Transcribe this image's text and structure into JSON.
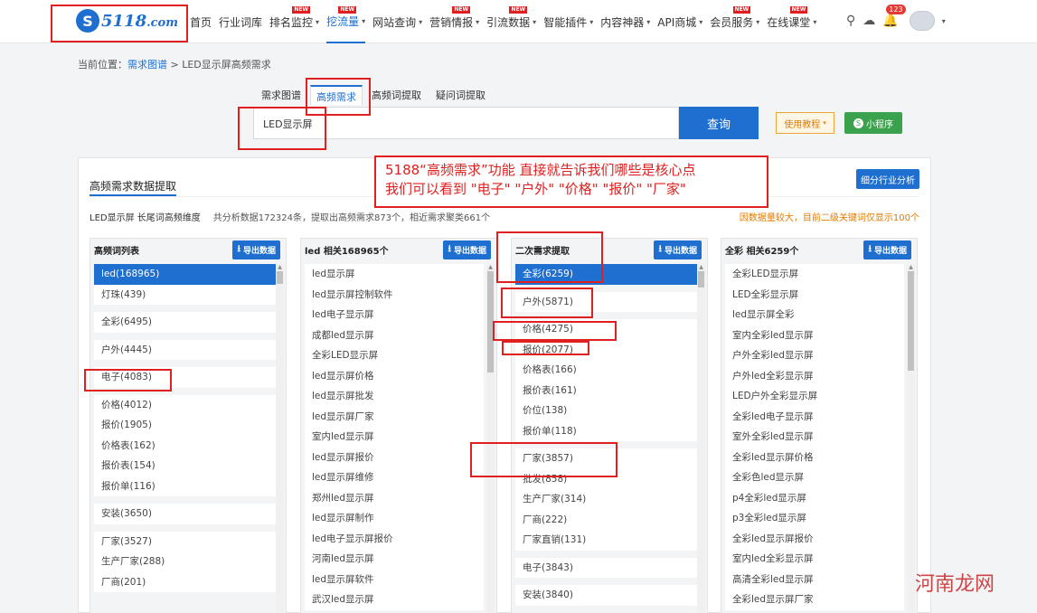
{
  "logo": {
    "mark": "S",
    "text": "5118",
    "suffix": ".com"
  },
  "nav": {
    "items": [
      {
        "label": "首页",
        "caret": false,
        "new": false
      },
      {
        "label": "行业词库",
        "caret": false,
        "new": false
      },
      {
        "label": "排名监控",
        "caret": true,
        "new": true
      },
      {
        "label": "挖流量",
        "caret": true,
        "new": true,
        "active": true
      },
      {
        "label": "网站查询",
        "caret": true,
        "new": false
      },
      {
        "label": "营销情报",
        "caret": true,
        "new": true
      },
      {
        "label": "引流数据",
        "caret": true,
        "new": true
      },
      {
        "label": "智能插件",
        "caret": true,
        "new": false
      },
      {
        "label": "内容神器",
        "caret": true,
        "new": false
      },
      {
        "label": "API商城",
        "caret": true,
        "new": false
      },
      {
        "label": "会员服务",
        "caret": true,
        "new": true
      },
      {
        "label": "在线课堂",
        "caret": true,
        "new": true
      }
    ],
    "new_badge": "NEW",
    "bell_count": "123"
  },
  "breadcrumb": {
    "prefix": "当前位置：",
    "link": "需求图谱",
    "sep": " > ",
    "current": "LED显示屏高频需求"
  },
  "tabs": [
    "需求图谱",
    "高频需求",
    "高频词提取",
    "疑问词提取"
  ],
  "search": {
    "value": "LED显示屏",
    "button": "查询",
    "tutorial": "使用教程",
    "mini": "小程序"
  },
  "panel": {
    "title": "高频需求数据提取",
    "analyze_button": "细分行业分析",
    "stats": {
      "keyword": "LED显示屏 长尾词高频维度",
      "summary": "共分析数据172324条，提取出高频需求873个，相近需求聚类661个"
    },
    "notice": "因数据量较大，目前二级关键词仅显示100个"
  },
  "export_label": "导出数据",
  "columns": [
    {
      "header": "高频词列表",
      "groups": [
        [
          "led(168965)",
          "灯珠(439)"
        ],
        [
          "全彩(6495)"
        ],
        [
          "户外(4445)"
        ],
        [
          "电子(4083)"
        ],
        [
          "价格(4012)",
          "报价(1905)",
          "价格表(162)",
          "报价表(154)",
          "报价单(116)"
        ],
        [
          "安装(3650)"
        ],
        [
          "厂家(3527)",
          "生产厂家(288)",
          "厂商(201)"
        ]
      ]
    },
    {
      "header": "led 相关168965个",
      "list": [
        "led显示屏",
        "led显示屏控制软件",
        "led电子显示屏",
        "成都led显示屏",
        "全彩LED显示屏",
        "led显示屏价格",
        "led显示屏批发",
        "led显示屏厂家",
        "室内led显示屏",
        "led显示屏报价",
        "led显示屏维修",
        "郑州led显示屏",
        "led显示屏制作",
        "led电子显示屏报价",
        "河南led显示屏",
        "led显示屏软件",
        "武汉led显示屏"
      ]
    },
    {
      "header": "二次需求提取",
      "groups": [
        [
          "全彩(6259)"
        ],
        [
          "户外(5871)"
        ],
        [
          "价格(4275)",
          "报价(2077)",
          "价格表(166)",
          "报价表(161)",
          "价位(138)",
          "报价单(118)"
        ],
        [
          "厂家(3857)",
          "批发(858)",
          "生产厂家(314)",
          "厂商(222)",
          "厂家直销(131)"
        ],
        [
          "电子(3843)"
        ],
        [
          "安装(3840)"
        ]
      ]
    },
    {
      "header": "全彩 相关6259个",
      "list": [
        "全彩LED显示屏",
        "LED全彩显示屏",
        "led显示屏全彩",
        "室内全彩led显示屏",
        "户外全彩led显示屏",
        "户外led全彩显示屏",
        "LED户外全彩显示屏",
        "全彩led电子显示屏",
        "室外全彩led显示屏",
        "全彩led显示屏价格",
        "全彩色led显示屏",
        "p4全彩led显示屏",
        "p3全彩led显示屏",
        "全彩led显示屏报价",
        "室内led全彩显示屏",
        "高清全彩led显示屏",
        "全彩led显示屏厂家"
      ]
    }
  ],
  "annotation": {
    "line1": "5188“高频需求”功能  直接就告诉我们哪些是核心点",
    "line2": "我们可以看到 \"电子\" \"户外\" \"价格\" \"报价\" \"厂家\""
  },
  "watermark": "河南龙网",
  "colors": {
    "brand": "#1e6fd0",
    "annotation": "#e02020",
    "green": "#3aa24d",
    "orange": "#e07b00"
  }
}
